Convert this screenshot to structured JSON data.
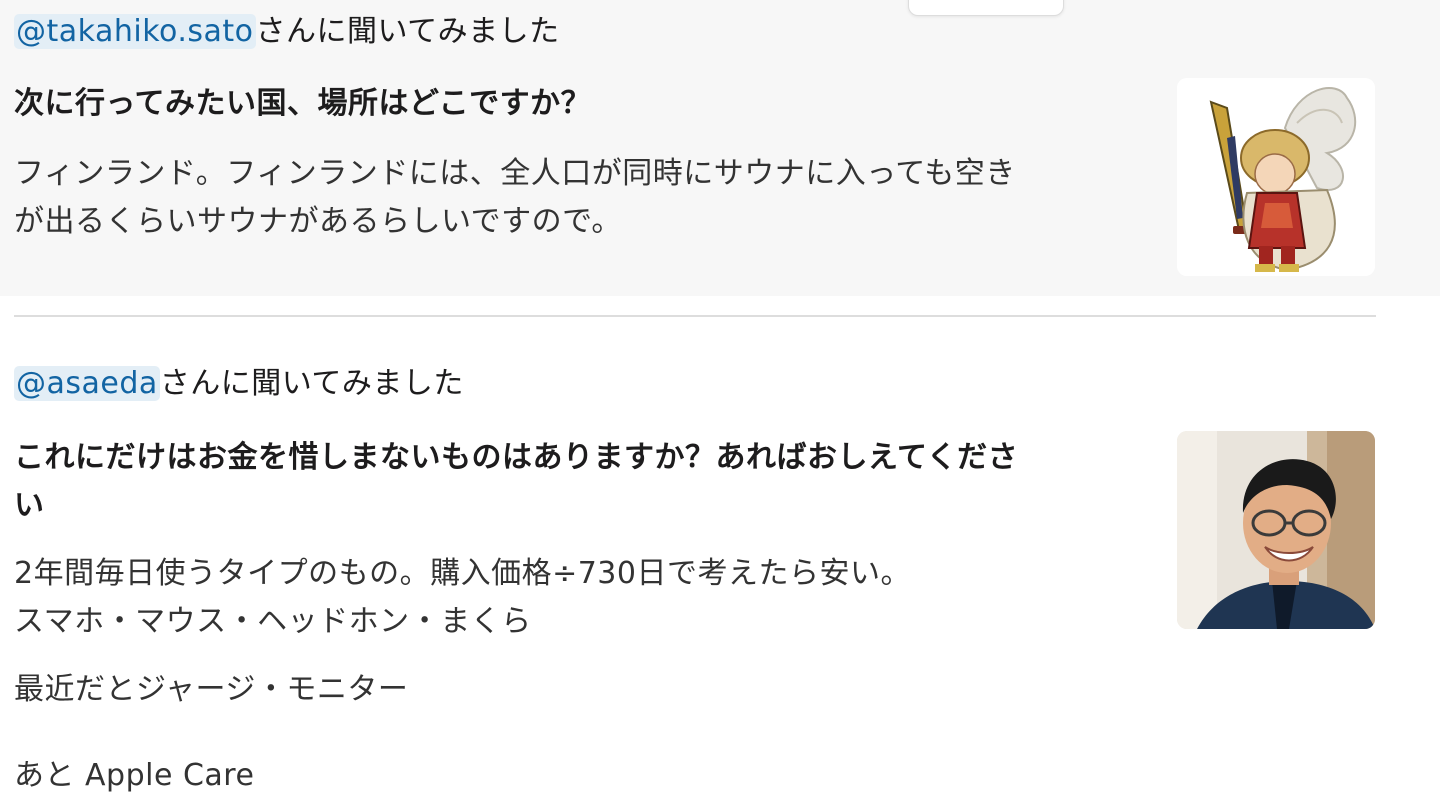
{
  "posts": [
    {
      "mention": "@takahiko.sato",
      "intro_suffix": "さんに聞いてみました",
      "question": "次に行ってみたい国、場所はどこですか？",
      "answer_lines": [
        "フィンランド。フィンランドには、全人口が同時にサウナに入っても空き",
        "が出るくらいサウナがあるらしいですので。"
      ],
      "thumbnail": "fantasy-warrior-character-illustration"
    },
    {
      "mention": "@asaeda",
      "intro_suffix": "さんに聞いてみました",
      "question": "これにだけはお金を惜しまないものはありますか？あればおしえてくださ\nい",
      "answer_lines": [
        "2年間毎日使うタイプのもの。購入価格÷730日で考えたら安い。",
        "スマホ・マウス・ヘッドホン・まくら",
        "最近だとジャージ・モニター",
        "あと Apple Care"
      ],
      "thumbnail": "smiling-man-with-glasses-photo"
    }
  ],
  "colors": {
    "mention_text": "#1264a3",
    "mention_bg": "#e3eef6",
    "highlight_bg": "#f7f7f7",
    "divider": "#dddddd"
  }
}
